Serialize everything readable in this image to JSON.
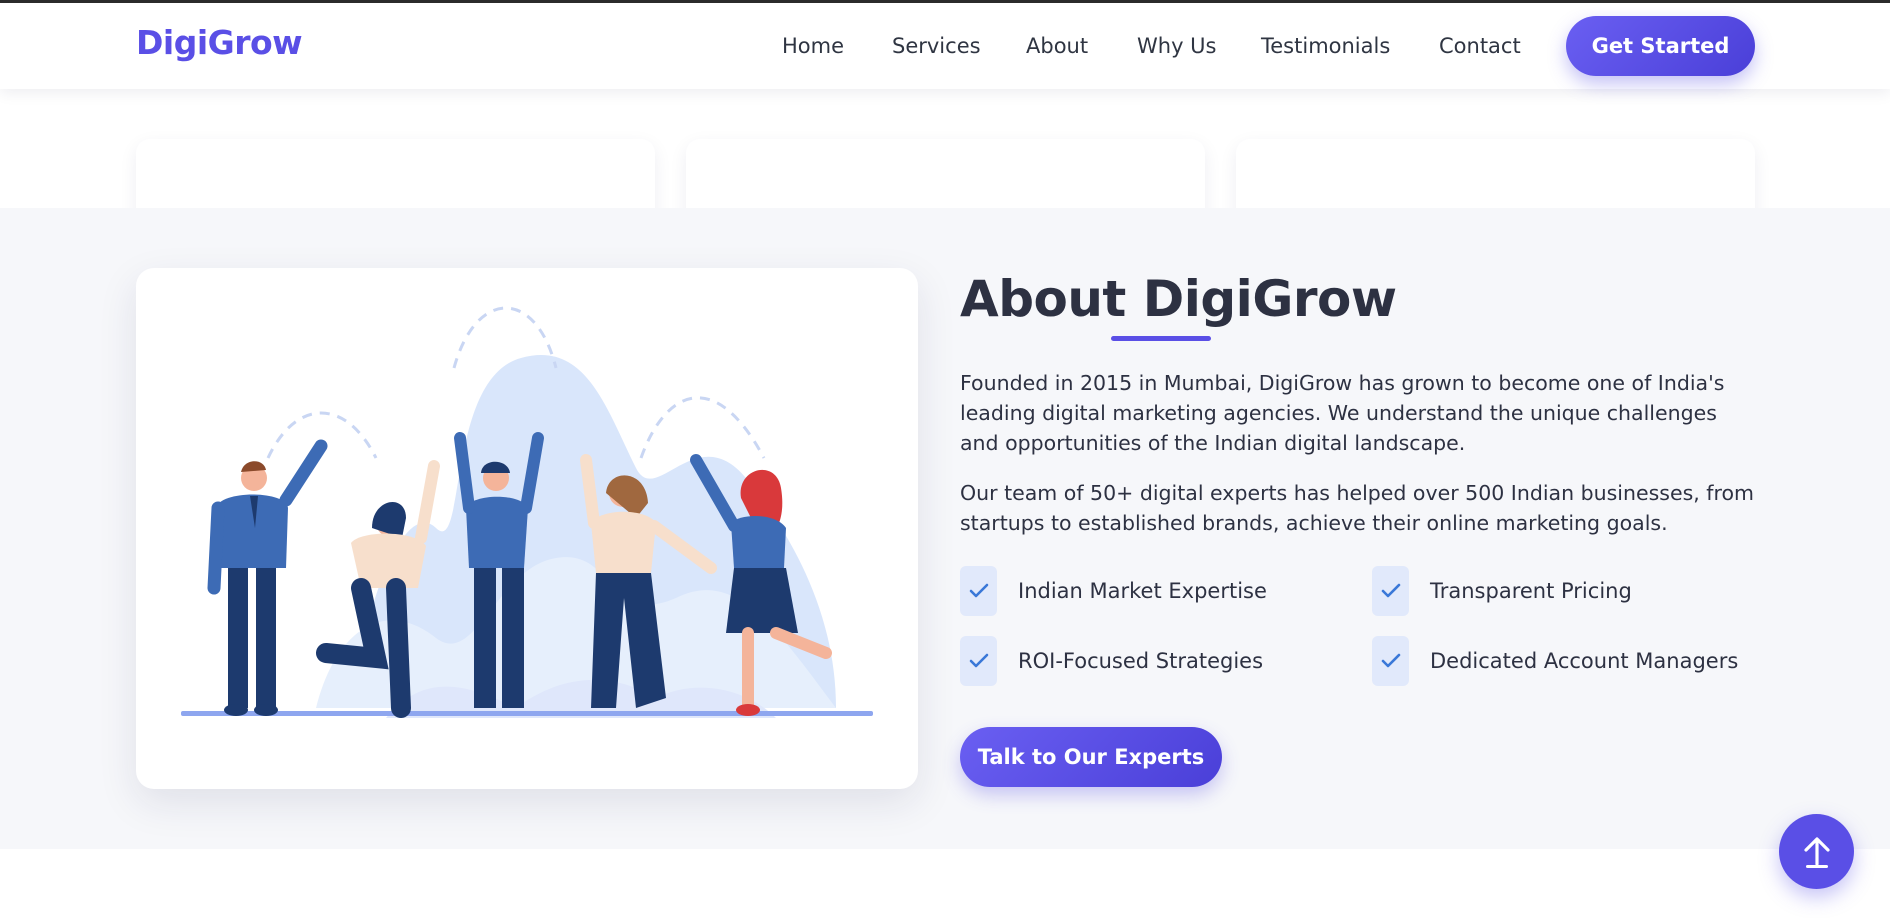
{
  "brand": {
    "logo": "DigiGrow",
    "accent": "#5a4fe6"
  },
  "nav": {
    "links": [
      "Home",
      "Services",
      "About",
      "Why Us",
      "Testimonials",
      "Contact"
    ],
    "cta": "Get Started"
  },
  "about": {
    "title": "About DigiGrow",
    "paragraphs": [
      "Founded in 2015 in Mumbai, DigiGrow has grown to become one of India's leading digital marketing agencies. We understand the unique challenges and opportunities of the Indian digital landscape.",
      "Our team of 50+ digital experts has helped over 500 Indian businesses, from startups to established brands, achieve their online marketing goals."
    ],
    "features": [
      "Indian Market Expertise",
      "Transparent Pricing",
      "ROI-Focused Strategies",
      "Dedicated Account Managers"
    ],
    "cta": "Talk to Our Experts"
  },
  "icons": {
    "check": "check-icon",
    "scroll_top": "arrow-up-icon"
  }
}
